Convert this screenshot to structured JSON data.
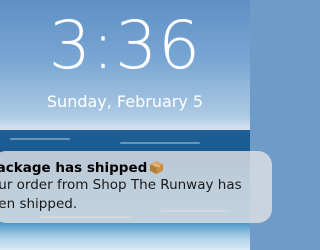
{
  "lock_screen": {
    "time": "3:36",
    "date": "Sunday, February 5"
  },
  "notification": {
    "title": "package has shipped",
    "icon": "package-icon",
    "body": "our order from Shop The Runway has\neen shipped."
  },
  "colors": {
    "text_on_wallpaper": "#ffffff",
    "notification_background": "#dee0e4",
    "notification_title": "#000000"
  }
}
